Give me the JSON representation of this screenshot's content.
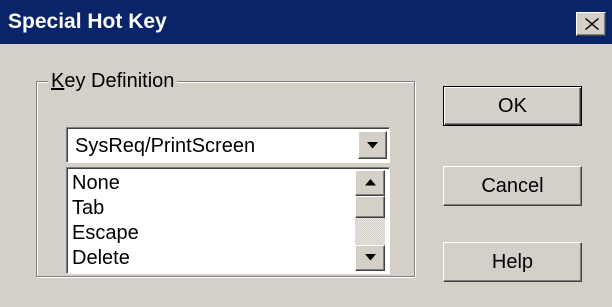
{
  "window": {
    "title": "Special Hot Key",
    "close_icon": "close-icon"
  },
  "group": {
    "legend_mnemonic": "K",
    "legend_rest": "ey Definition"
  },
  "combo": {
    "selected_value": "SysReq/PrintScreen",
    "dropdown_icon": "chevron-down-icon"
  },
  "list": {
    "items": [
      "None",
      "Tab",
      "Escape",
      "Delete"
    ],
    "scrollbar_up_icon": "scroll-up-arrow-icon",
    "scrollbar_down_icon": "scroll-down-arrow-icon"
  },
  "buttons": {
    "ok": "OK",
    "cancel": "Cancel",
    "help": "Help"
  },
  "colors": {
    "titlebar": "#0a246a",
    "face": "#d4d0c8"
  }
}
